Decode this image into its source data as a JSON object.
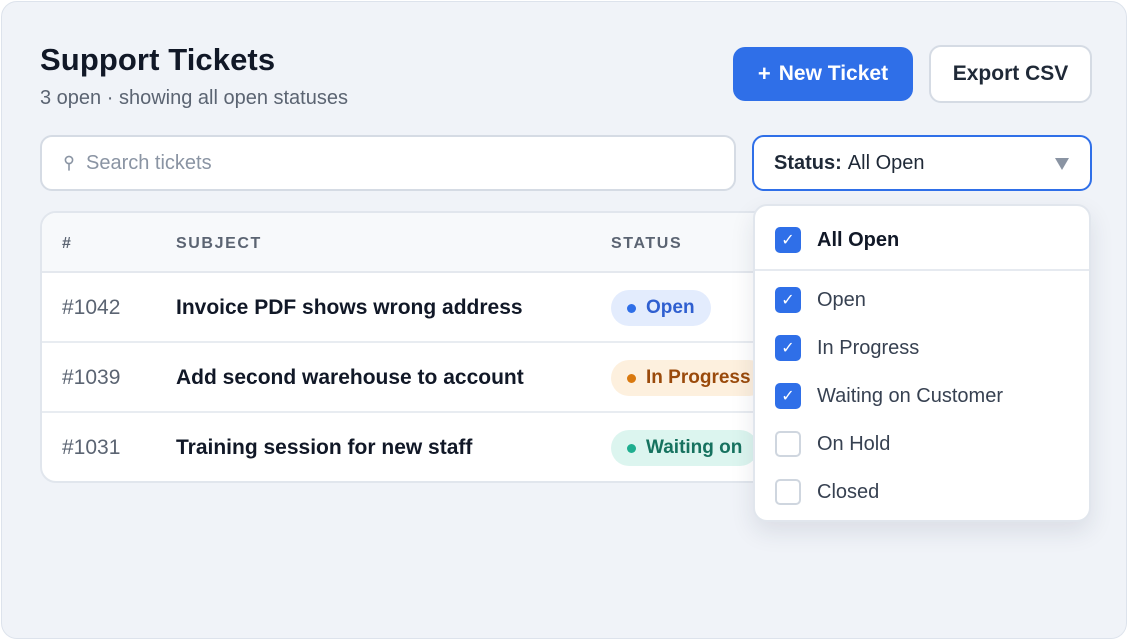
{
  "header": {
    "title": "Support Tickets",
    "subtitle": "3 open · showing all open statuses"
  },
  "toolbar": {
    "new_ticket_label": "New Ticket",
    "new_ticket_icon": "plus-icon",
    "export_label": "Export CSV"
  },
  "search": {
    "placeholder": "Search tickets",
    "value": "",
    "icon": "search-icon"
  },
  "status_filter": {
    "label": "Status:",
    "value": "All Open",
    "icon": "chevron-down-icon"
  },
  "table": {
    "columns": [
      "#",
      "SUBJECT",
      "STATUS"
    ],
    "rows": [
      {
        "id": "#1042",
        "subject": "Invoice PDF shows wrong address",
        "status": "Open"
      },
      {
        "id": "#1039",
        "subject": "Add second warehouse to account",
        "status": "In Progress"
      },
      {
        "id": "#1031",
        "subject": "Training session for new staff",
        "status": "Waiting on"
      }
    ]
  },
  "status_dropdown": {
    "all_label": "All Open",
    "all_checked": true,
    "options": [
      {
        "label": "Open",
        "checked": true
      },
      {
        "label": "In Progress",
        "checked": true
      },
      {
        "label": "Waiting on Customer",
        "checked": true
      },
      {
        "label": "On Hold",
        "checked": false
      },
      {
        "label": "Closed",
        "checked": false
      }
    ]
  },
  "colors": {
    "accent": "#2f6fe8",
    "open_bg": "#e3ecfd",
    "open_text": "#2f5fd0",
    "open_dot": "#2f6fe8",
    "progress_bg": "#fdf0de",
    "progress_text": "#9a4a0b",
    "progress_dot": "#d9790f",
    "waiting_bg": "#dcf5ef",
    "waiting_text": "#16725f",
    "waiting_dot": "#1fae8f"
  }
}
